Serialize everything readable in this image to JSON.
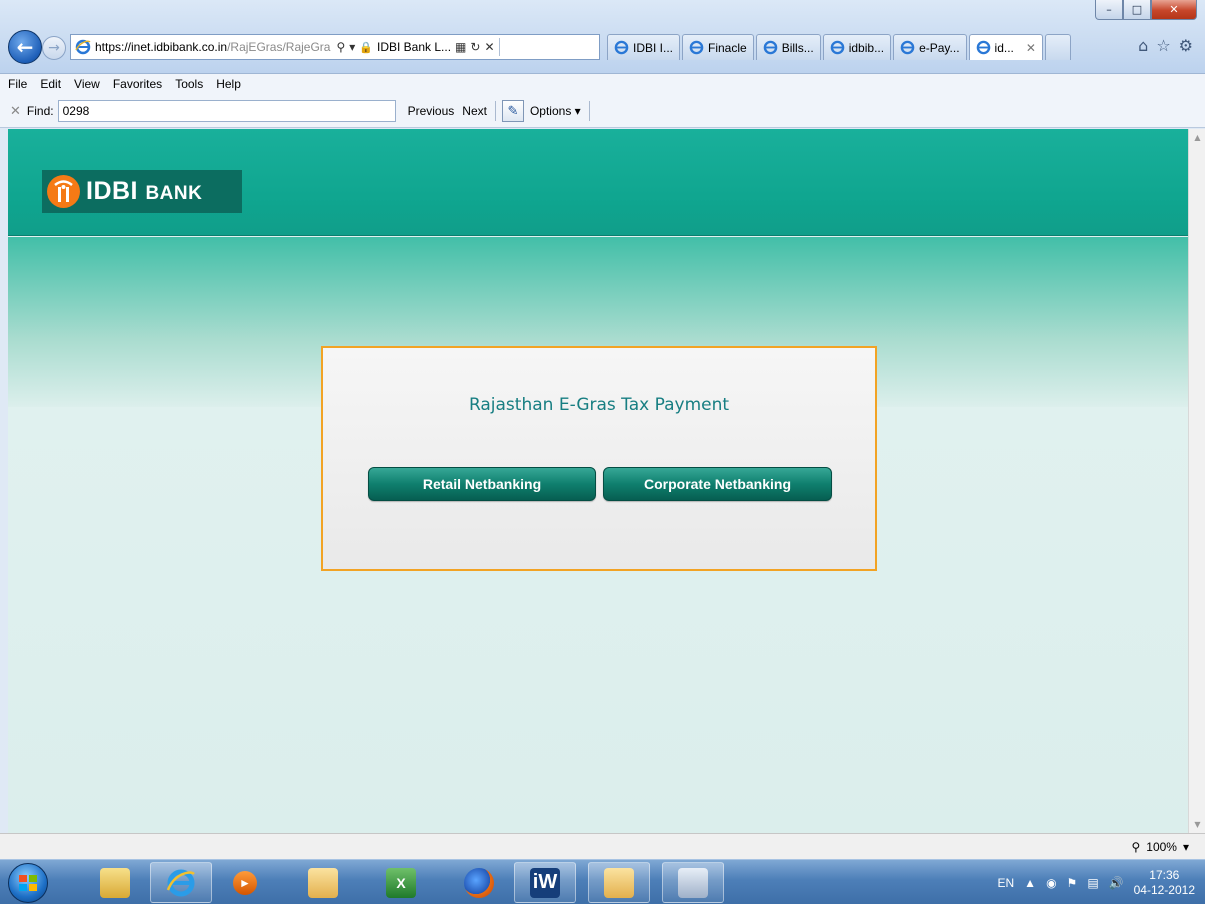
{
  "browser": {
    "address": {
      "url_host": "https://inet.idbibank.co.in",
      "url_path": "/RajEGras/RajeGra",
      "site_label": "IDBI Bank L..."
    },
    "tabs": [
      {
        "label": "IDBI I...",
        "active": false
      },
      {
        "label": "Finacle",
        "active": false
      },
      {
        "label": "Bills...",
        "active": false
      },
      {
        "label": "idbib...",
        "active": false
      },
      {
        "label": "e-Pay...",
        "active": false
      },
      {
        "label": "id...",
        "active": true
      }
    ],
    "menu": [
      "File",
      "Edit",
      "View",
      "Favorites",
      "Tools",
      "Help"
    ],
    "find": {
      "label": "Find:",
      "value": "0298",
      "previous": "Previous",
      "next": "Next",
      "options": "Options"
    },
    "status": {
      "zoom": "100%"
    }
  },
  "page": {
    "logo": {
      "main": "IDBI",
      "sub": "BANK"
    },
    "title": "Rajasthan E-Gras Tax Payment",
    "buttons": {
      "retail": "Retail Netbanking",
      "corporate": "Corporate Netbanking"
    }
  },
  "taskbar": {
    "language": "EN",
    "time": "17:36",
    "date": "04-12-2012"
  },
  "colors": {
    "banner": "#0fa58f",
    "panel_border": "#f2a324",
    "title_text": "#177e82",
    "button": "#0f7f6e",
    "logo_mark": "#f57a15"
  }
}
